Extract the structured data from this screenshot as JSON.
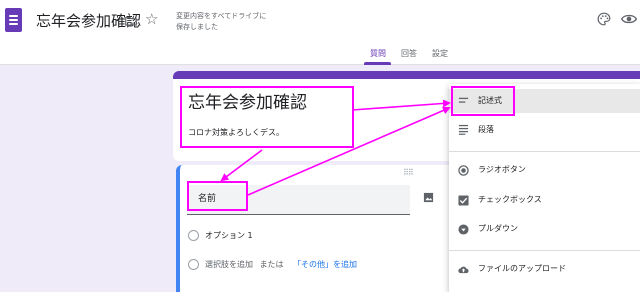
{
  "header": {
    "doc_title": "忘年会参加確認",
    "save_status_line1": "変更内容をすべてドライブに",
    "save_status_line2": "保存しました",
    "icons": [
      "forms-app-icon",
      "folder-icon",
      "star-icon",
      "palette-icon",
      "preview-eye-icon"
    ]
  },
  "tabs": [
    {
      "label": "質問",
      "active": true
    },
    {
      "label": "回答",
      "active": false
    },
    {
      "label": "設定",
      "active": false
    }
  ],
  "form": {
    "title": "忘年会参加確認",
    "description": "コロナ対策よろしくデス。"
  },
  "question": {
    "title": "名前",
    "option1": "オプション 1",
    "add_option": "選択肢を追加",
    "or_text": "または",
    "add_other": "「その他」を追加"
  },
  "type_menu": {
    "items": [
      {
        "label": "記述式",
        "icon": "short-answer-icon",
        "selected": true
      },
      {
        "label": "段落",
        "icon": "paragraph-icon",
        "selected": false
      },
      {
        "label": "ラジオボタン",
        "icon": "radio-button-icon",
        "selected": false
      },
      {
        "label": "チェックボックス",
        "icon": "checkbox-icon",
        "selected": false
      },
      {
        "label": "プルダウン",
        "icon": "dropdown-icon",
        "selected": false
      },
      {
        "label": "ファイルのアップロード",
        "icon": "cloud-upload-icon",
        "selected": false
      }
    ]
  },
  "colors": {
    "brand_purple": "#673ab7",
    "annotation_magenta": "#ff00ff",
    "active_blue": "#4285f4",
    "link_blue": "#1a73e8",
    "page_bg": "#f0ebf8"
  }
}
